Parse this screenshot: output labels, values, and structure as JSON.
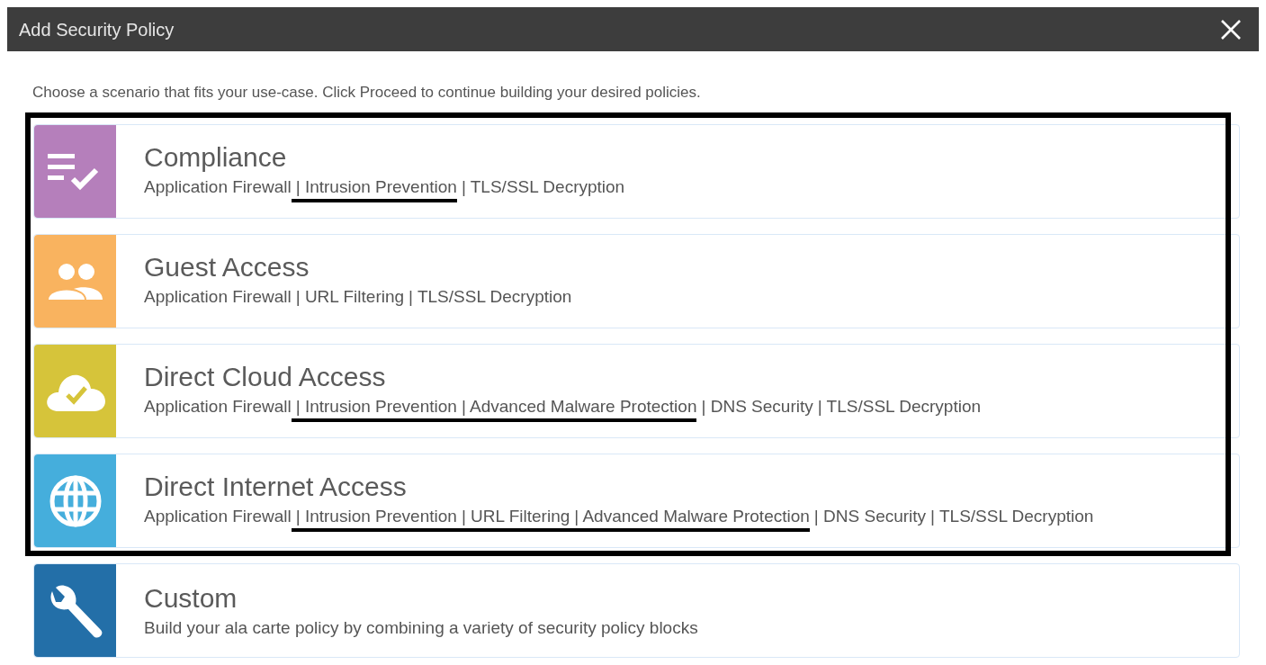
{
  "window": {
    "title": "Add Security Policy"
  },
  "intro": "Choose a scenario that fits your use-case. Click Proceed to continue building your desired policies.",
  "scenarios": [
    {
      "kind": "checklist",
      "color": "#b57fbb",
      "title": "Compliance",
      "framed": true,
      "features": [
        {
          "text": "Application Firewall",
          "marked": false
        },
        {
          "text": "| Intrusion Prevention",
          "marked": true
        },
        {
          "text": "| TLS/SSL Decryption",
          "marked": false
        }
      ]
    },
    {
      "kind": "people",
      "color": "#f9b35f",
      "title": "Guest Access",
      "framed": true,
      "features": [
        {
          "text": "Application Firewall",
          "marked": false
        },
        {
          "text": "| URL Filtering",
          "marked": false
        },
        {
          "text": "| TLS/SSL Decryption",
          "marked": false
        }
      ]
    },
    {
      "kind": "cloud",
      "color": "#d6c43a",
      "title": "Direct Cloud Access",
      "framed": true,
      "features": [
        {
          "text": "Application Firewall",
          "marked": false
        },
        {
          "text": "| Intrusion Prevention",
          "marked": true
        },
        {
          "text": "| Advanced Malware Protection",
          "marked": true
        },
        {
          "text": "| DNS Security",
          "marked": false
        },
        {
          "text": "| TLS/SSL Decryption",
          "marked": false
        }
      ]
    },
    {
      "kind": "globe",
      "color": "#45aedc",
      "title": "Direct Internet Access",
      "framed": true,
      "features": [
        {
          "text": "Application Firewall",
          "marked": false
        },
        {
          "text": "| Intrusion Prevention",
          "marked": true
        },
        {
          "text": "| URL Filtering",
          "marked": true
        },
        {
          "text": "| Advanced Malware Protection",
          "marked": true
        },
        {
          "text": "| DNS Security",
          "marked": false
        },
        {
          "text": "| TLS/SSL Decryption",
          "marked": false
        }
      ]
    },
    {
      "kind": "wrench",
      "color": "#236fa8",
      "title": "Custom",
      "framed": false,
      "description": "Build your ala carte policy by combining a variety of security policy blocks"
    }
  ]
}
